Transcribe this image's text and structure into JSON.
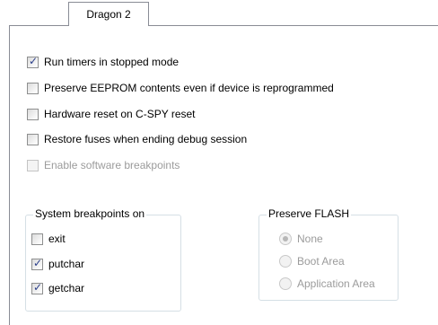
{
  "tab": {
    "label": "Dragon 2"
  },
  "options": [
    {
      "label": "Run timers in stopped mode",
      "checked": true,
      "enabled": true
    },
    {
      "label": "Preserve EEPROM contents even if device is reprogrammed",
      "checked": false,
      "enabled": true
    },
    {
      "label": "Hardware reset on C-SPY reset",
      "checked": false,
      "enabled": true
    },
    {
      "label": "Restore fuses when ending debug session",
      "checked": false,
      "enabled": true
    },
    {
      "label": "Enable software breakpoints",
      "checked": false,
      "enabled": false
    }
  ],
  "system_breakpoints": {
    "title": "System breakpoints on",
    "items": [
      {
        "label": "exit",
        "checked": false
      },
      {
        "label": "putchar",
        "checked": true
      },
      {
        "label": "getchar",
        "checked": true
      }
    ]
  },
  "preserve_flash": {
    "title": "Preserve FLASH",
    "enabled": false,
    "items": [
      {
        "label": "None",
        "selected": true
      },
      {
        "label": "Boot Area",
        "selected": false
      },
      {
        "label": "Application Area",
        "selected": false
      }
    ]
  },
  "check_glyph": "✓"
}
